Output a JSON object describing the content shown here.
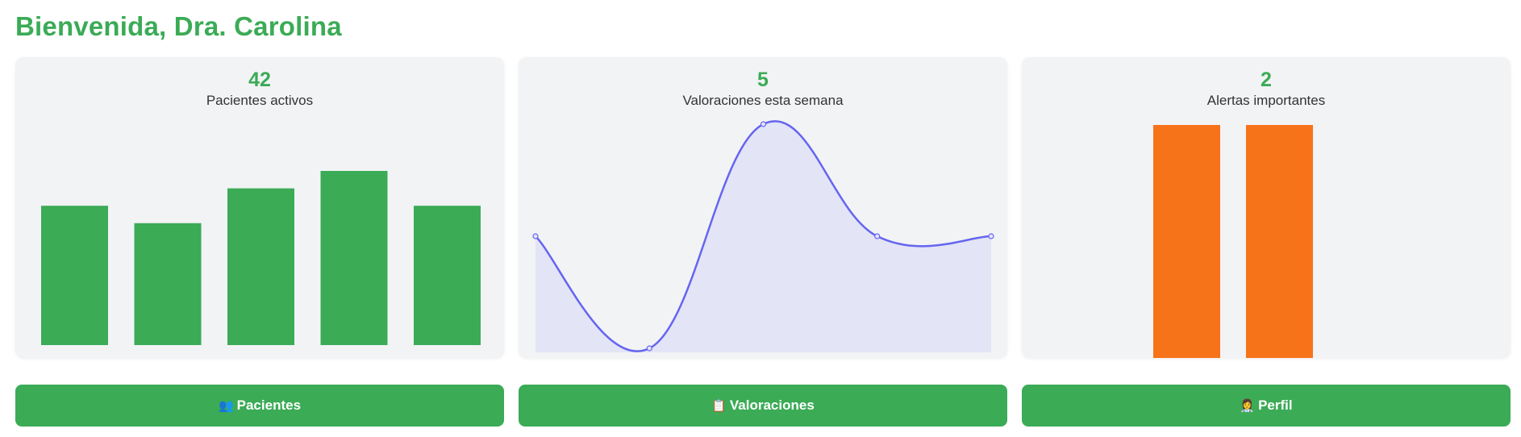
{
  "header": {
    "title": "Bienvenida, Dra. Carolina"
  },
  "cards": [
    {
      "value": "42",
      "label": "Pacientes activos"
    },
    {
      "value": "5",
      "label": "Valoraciones esta semana"
    },
    {
      "value": "2",
      "label": "Alertas importantes"
    }
  ],
  "buttons": [
    {
      "icon": "👥",
      "label": "Pacientes"
    },
    {
      "icon": "📋",
      "label": "Valoraciones"
    },
    {
      "icon": "👩‍⚕️",
      "label": "Perfil"
    }
  ],
  "colors": {
    "green": "#3bab56",
    "orange": "#f77319",
    "line": "#6565f0",
    "fill": "#e3e4f5"
  },
  "chart_data": [
    {
      "type": "bar",
      "values": [
        8,
        7,
        9,
        10,
        8
      ],
      "ylim": [
        0,
        10
      ]
    },
    {
      "type": "line",
      "values": [
        5,
        0,
        10,
        5,
        5
      ],
      "ylim": [
        0,
        10
      ]
    },
    {
      "type": "bar",
      "values": [
        1,
        1
      ],
      "ylim": [
        0,
        1
      ]
    }
  ]
}
